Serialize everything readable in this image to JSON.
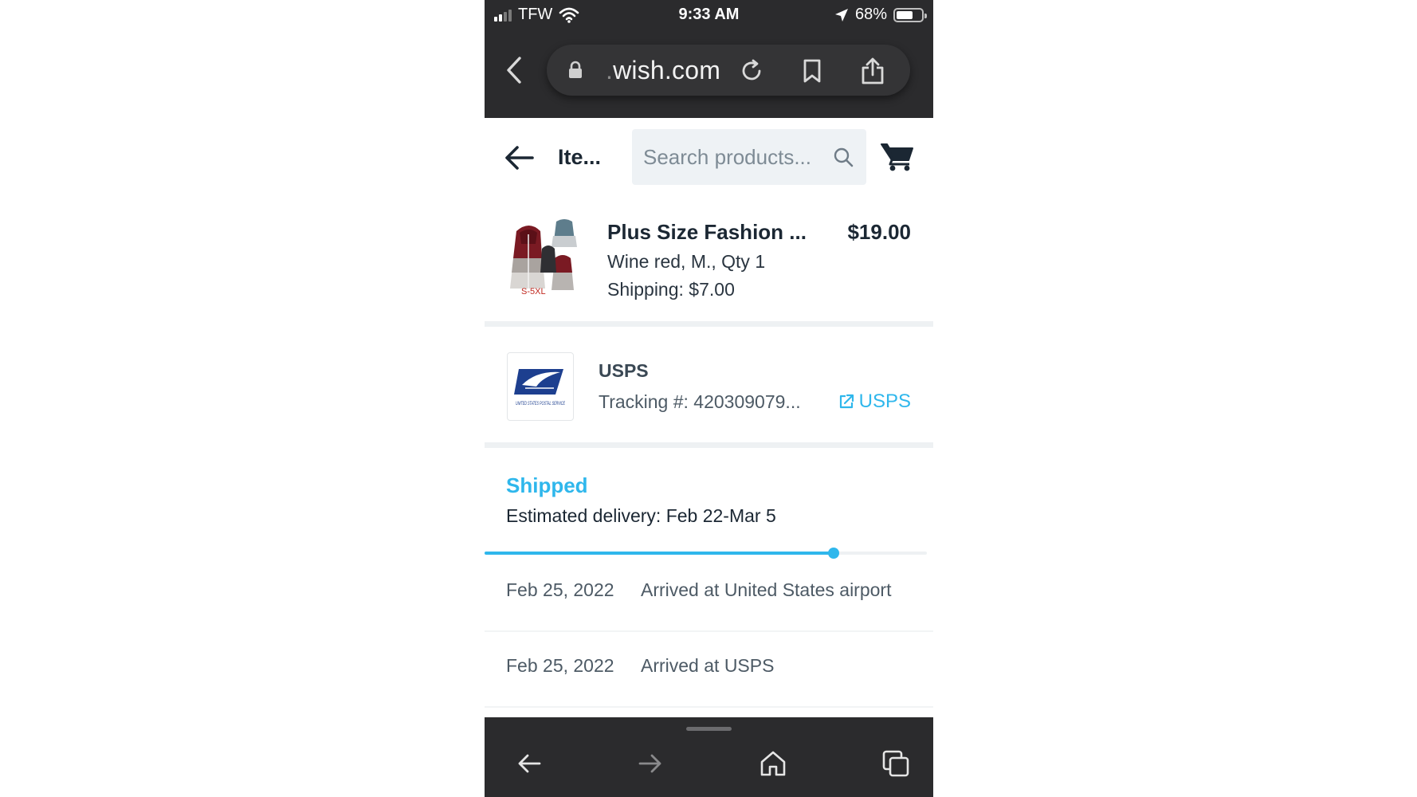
{
  "status_bar": {
    "carrier": "TFW",
    "time": "9:33 AM",
    "battery_text": "68%",
    "battery_level": 0.68
  },
  "browser": {
    "url_faint": ".",
    "url": "wish.com"
  },
  "header": {
    "title": "Ite...",
    "search_placeholder": "Search products..."
  },
  "product": {
    "name": "Plus Size Fashion ...",
    "price": "$19.00",
    "variant": "Wine red, M., Qty 1",
    "shipping": "Shipping: $7.00",
    "image_tag": "S-5XL"
  },
  "carrier": {
    "name": "USPS",
    "tracking": "Tracking #: 420309079...",
    "link_label": "USPS",
    "logo_text": "UNITED STATES POSTAL SERVICE"
  },
  "shipment": {
    "status": "Shipped",
    "estimated": "Estimated delivery: Feb 22-Mar 5",
    "progress": 0.79,
    "events": [
      {
        "date": "Feb 25, 2022",
        "description": "Arrived at United States airport"
      },
      {
        "date": "Feb 25, 2022",
        "description": "Arrived at USPS"
      }
    ]
  },
  "colors": {
    "accent": "#2fb7ec",
    "chrome": "#2b2b2d",
    "text": "#1b2733"
  },
  "icons": {
    "back": "chevron-left-icon",
    "lock": "lock-icon",
    "reload": "reload-icon",
    "bookmark": "bookmark-icon",
    "share": "share-icon",
    "search": "search-icon",
    "cart": "cart-icon",
    "external": "external-link-icon",
    "home": "home-icon",
    "tabs": "tabs-icon"
  }
}
